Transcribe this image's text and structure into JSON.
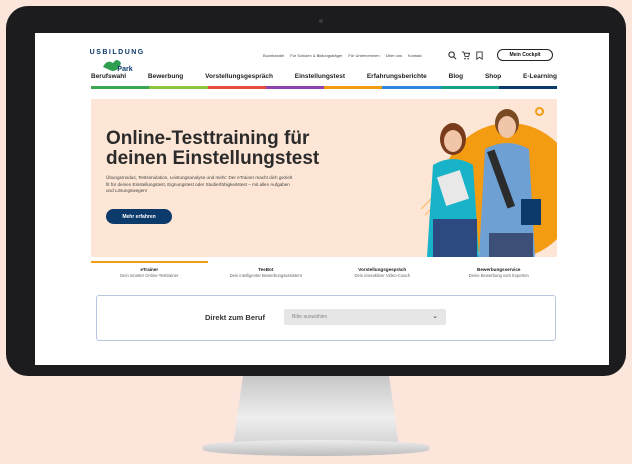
{
  "header": {
    "logo_text": "AUSBILDUNGSPark",
    "top_links": [
      "Buchhandel",
      "Für Schulen & Bildungsträger",
      "Für Unternehmen",
      "Über uns",
      "Kontakt"
    ],
    "cockpit_label": "Mein Cockpit",
    "icons": [
      "search-icon",
      "cart-icon",
      "bookmark-icon"
    ]
  },
  "nav": {
    "items": [
      "Berufswahl",
      "Bewerbung",
      "Vorstellungsgespräch",
      "Einstellungstest",
      "Erfahrungsberichte",
      "Blog",
      "Shop",
      "E-Learning"
    ],
    "bar_colors": [
      "#3aa757",
      "#8cc63f",
      "#e74c3c",
      "#8e44ad",
      "#f39c12",
      "#2e86de",
      "#16a085",
      "#0c3a6b"
    ]
  },
  "hero": {
    "title": "Online-Testtraining für deinen Einstellungstest",
    "description": "Übungsmodus, Testsimulation, Leistungsanalyse und mehr: Der eTrainer macht dich gezielt fit für deinen Einstellungstest, Eignungstest oder Studierfähigkeitstest – mit allen Aufgaben und Lösungswegen!",
    "button_label": "Mehr erfahren",
    "background_color": "#fde6d5",
    "accent_color": "#f39c12"
  },
  "tabs": [
    {
      "title": "eTrainer",
      "subtitle": "Dein smarter Online-Testtrainer"
    },
    {
      "title": "TesBot",
      "subtitle": "Dein intelligenter Bewerbungsassistent"
    },
    {
      "title": "Vorstellungsgespräch",
      "subtitle": "Dein interaktiver Video-Coach"
    },
    {
      "title": "Bewerbungsservice",
      "subtitle": "Deine Bewerbung vom Experten"
    }
  ],
  "beruf": {
    "label": "Direkt zum Beruf",
    "select_value": "Bitte auswählen"
  }
}
